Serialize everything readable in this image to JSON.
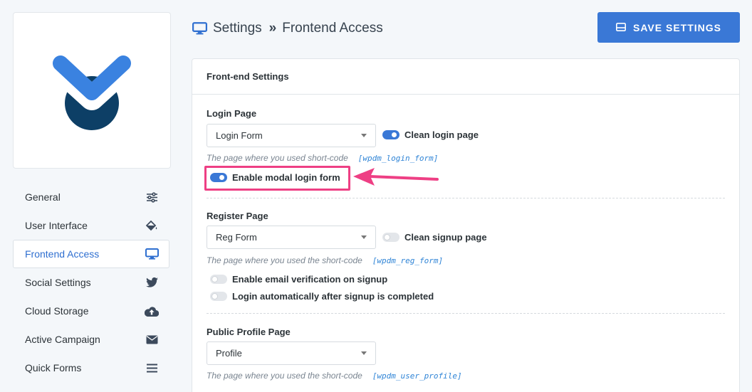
{
  "header": {
    "title": "Settings",
    "separator": "»",
    "subtitle": "Frontend Access",
    "save_label": "SAVE SETTINGS"
  },
  "sidebar": {
    "items": [
      {
        "label": "General",
        "icon": "sliders-icon"
      },
      {
        "label": "User Interface",
        "icon": "paint-bucket-icon"
      },
      {
        "label": "Frontend Access",
        "icon": "desktop-icon",
        "active": true
      },
      {
        "label": "Social Settings",
        "icon": "twitter-icon"
      },
      {
        "label": "Cloud Storage",
        "icon": "cloud-upload-icon"
      },
      {
        "label": "Active Campaign",
        "icon": "envelope-icon"
      },
      {
        "label": "Quick Forms",
        "icon": "bars-icon"
      }
    ]
  },
  "panel": {
    "title": "Front-end Settings",
    "login": {
      "label": "Login Page",
      "select_value": "Login Form",
      "clean_label": "Clean login page",
      "clean_on": true,
      "hint": "The page where you used short-code",
      "shortcode": "[wpdm_login_form]",
      "modal_label": "Enable modal login form",
      "modal_on": true
    },
    "register": {
      "label": "Register Page",
      "select_value": "Reg Form",
      "clean_label": "Clean signup page",
      "clean_on": false,
      "hint": "The page where you used the short-code",
      "shortcode": "[wpdm_reg_form]",
      "verify_label": "Enable email verification on signup",
      "verify_on": false,
      "autologin_label": "Login automatically after signup is completed",
      "autologin_on": false
    },
    "profile": {
      "label": "Public Profile Page",
      "select_value": "Profile",
      "hint": "The page where you used the short-code",
      "shortcode": "[wpdm_user_profile]"
    }
  },
  "colors": {
    "accent": "#3a78d6",
    "highlight": "#ee3f84",
    "logo_dark": "#0d3f66",
    "logo_light": "#3a82e0"
  }
}
